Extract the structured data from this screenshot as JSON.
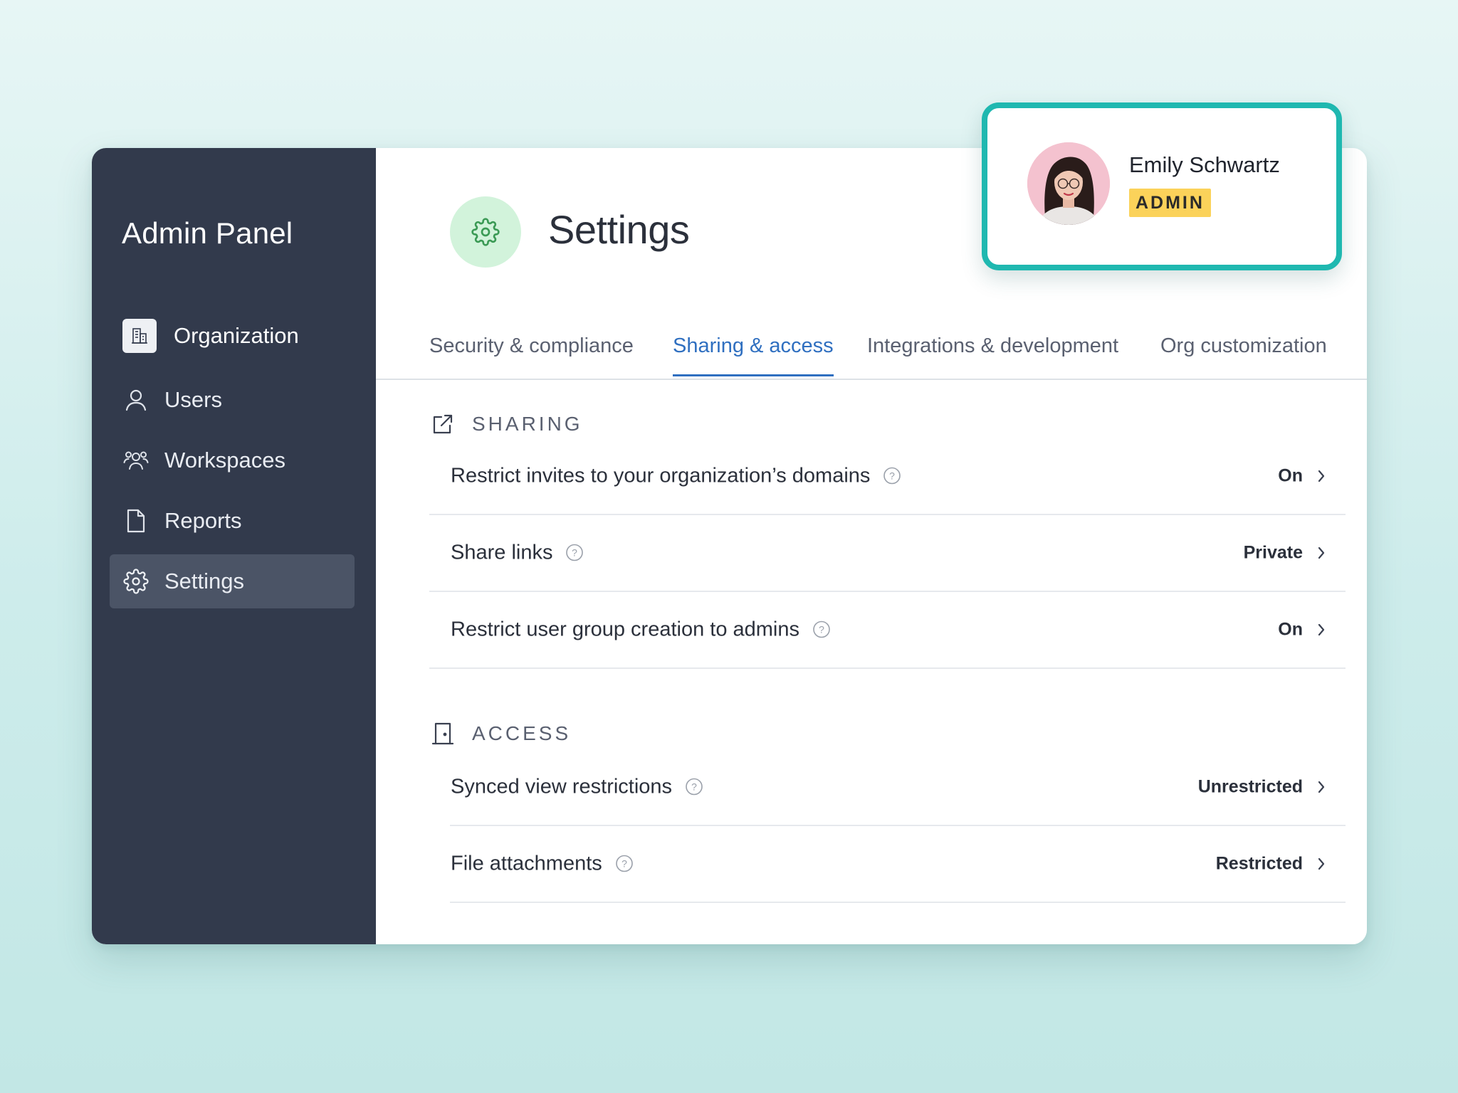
{
  "sidebar": {
    "title": "Admin Panel",
    "items": [
      {
        "label": "Organization",
        "icon": "building-icon"
      },
      {
        "label": "Users",
        "icon": "user-icon"
      },
      {
        "label": "Workspaces",
        "icon": "users-group-icon"
      },
      {
        "label": "Reports",
        "icon": "document-icon"
      },
      {
        "label": "Settings",
        "icon": "gear-icon",
        "active": true
      }
    ]
  },
  "header": {
    "title": "Settings",
    "icon": "gear-icon"
  },
  "tabs": [
    {
      "label": "Security & compliance"
    },
    {
      "label": "Sharing & access",
      "active": true
    },
    {
      "label": "Integrations & development"
    },
    {
      "label": "Org customization"
    }
  ],
  "sections": {
    "sharing": {
      "title": "SHARING",
      "icon": "external-link-icon",
      "rows": [
        {
          "label": "Restrict invites to your organization’s domains",
          "value": "On"
        },
        {
          "label": "Share links",
          "value": "Private"
        },
        {
          "label": "Restrict user group creation to admins",
          "value": "On"
        }
      ]
    },
    "access": {
      "title": "ACCESS",
      "icon": "door-icon",
      "rows": [
        {
          "label": "Synced view restrictions",
          "value": "Unrestricted"
        },
        {
          "label": "File attachments",
          "value": "Restricted"
        }
      ]
    }
  },
  "profile": {
    "name": "Emily Schwartz",
    "role": "ADMIN"
  },
  "colors": {
    "sidebar_bg": "#323a4c",
    "sidebar_active": "#4b5466",
    "accent_blue": "#2f6fc0",
    "profile_border": "#1fb8b0",
    "badge_yellow": "#fbd25a",
    "settings_icon_bg": "#d2f3db"
  }
}
